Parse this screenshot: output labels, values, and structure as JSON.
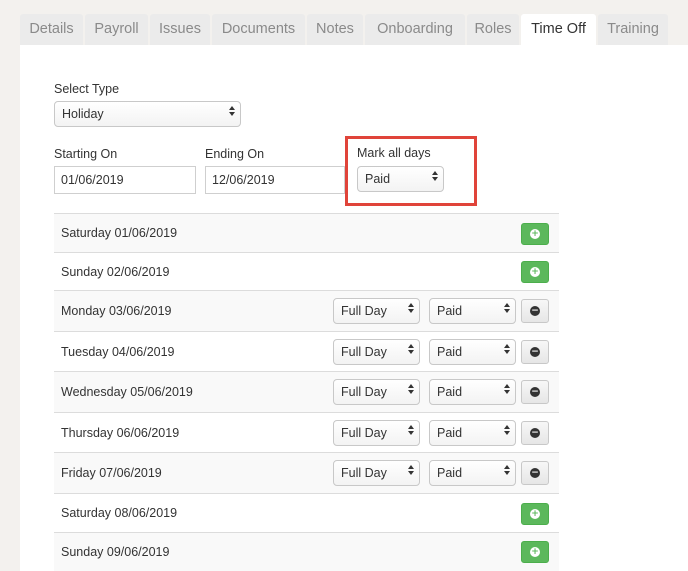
{
  "tabs": [
    "Details",
    "Payroll",
    "Issues",
    "Documents",
    "Notes",
    "Onboarding",
    "Roles",
    "Time Off",
    "Training"
  ],
  "active_tab": "Time Off",
  "form": {
    "select_type_label": "Select Type",
    "select_type_value": "Holiday",
    "starting_on_label": "Starting On",
    "starting_on_value": "01/06/2019",
    "ending_on_label": "Ending On",
    "ending_on_value": "12/06/2019",
    "mark_all_label": "Mark all days",
    "mark_all_value": "Paid"
  },
  "days": [
    {
      "date": "Saturday 01/06/2019",
      "included": false
    },
    {
      "date": "Sunday 02/06/2019",
      "included": false
    },
    {
      "date": "Monday 03/06/2019",
      "included": true,
      "duration": "Full Day",
      "pay": "Paid"
    },
    {
      "date": "Tuesday 04/06/2019",
      "included": true,
      "duration": "Full Day",
      "pay": "Paid"
    },
    {
      "date": "Wednesday 05/06/2019",
      "included": true,
      "duration": "Full Day",
      "pay": "Paid"
    },
    {
      "date": "Thursday 06/06/2019",
      "included": true,
      "duration": "Full Day",
      "pay": "Paid"
    },
    {
      "date": "Friday 07/06/2019",
      "included": true,
      "duration": "Full Day",
      "pay": "Paid"
    },
    {
      "date": "Saturday 08/06/2019",
      "included": false
    },
    {
      "date": "Sunday 09/06/2019",
      "included": false
    }
  ],
  "colors": {
    "add_button": "#5cb85c",
    "highlight_border": "#e0443a",
    "tab_inactive": "#ebebeb",
    "page_background": "#f3f1ee"
  },
  "icons": {
    "add": "plus-circle-icon",
    "remove": "minus-circle-icon",
    "select_arrow": "updown-arrow-icon"
  }
}
